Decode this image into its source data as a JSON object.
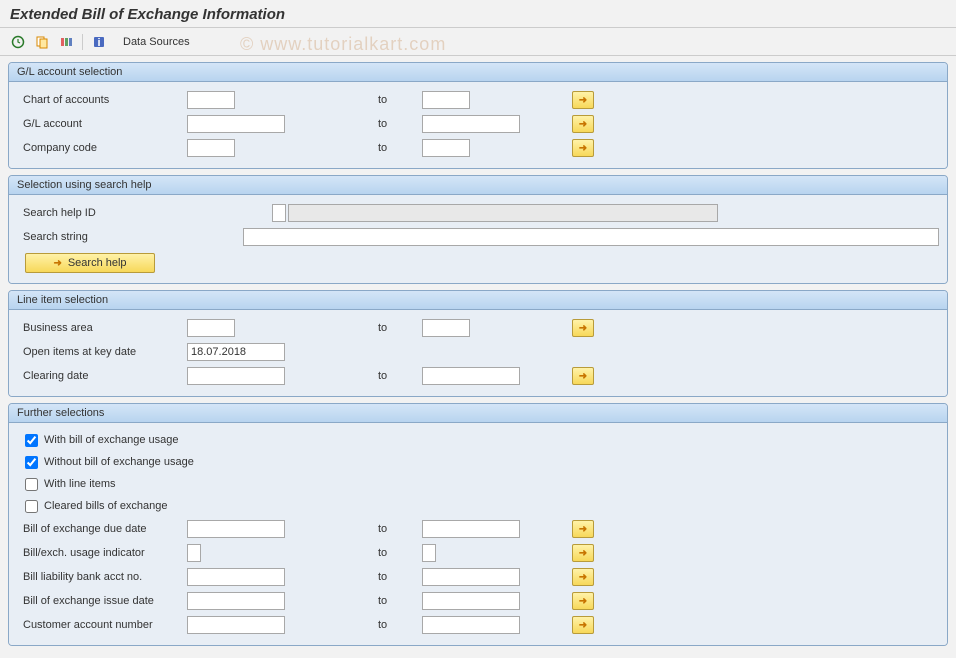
{
  "title": "Extended Bill of Exchange Information",
  "toolbar": {
    "data_sources": "Data Sources"
  },
  "watermark": "© www.tutorialkart.com",
  "groups": {
    "gl": {
      "title": "G/L account selection",
      "chart_of_accounts": "Chart of accounts",
      "gl_account": "G/L account",
      "company_code": "Company code",
      "to": "to"
    },
    "search": {
      "title": "Selection using search help",
      "search_help_id": "Search help ID",
      "search_string": "Search string",
      "btn": "Search help"
    },
    "line": {
      "title": "Line item selection",
      "business_area": "Business area",
      "open_items": "Open items at key date",
      "open_items_value": "18.07.2018",
      "clearing_date": "Clearing date",
      "to": "to"
    },
    "further": {
      "title": "Further selections",
      "chk1": "With bill of exchange usage",
      "chk2": "Without bill of exchange usage",
      "chk3": "With line items",
      "chk4": "Cleared bills of exchange",
      "bill_due": "Bill of exchange due date",
      "bill_usage": "Bill/exch. usage indicator",
      "bill_liability": "Bill liability bank acct no.",
      "bill_issue": "Bill of exchange issue date",
      "cust_acct": "Customer account number",
      "to": "to"
    }
  }
}
